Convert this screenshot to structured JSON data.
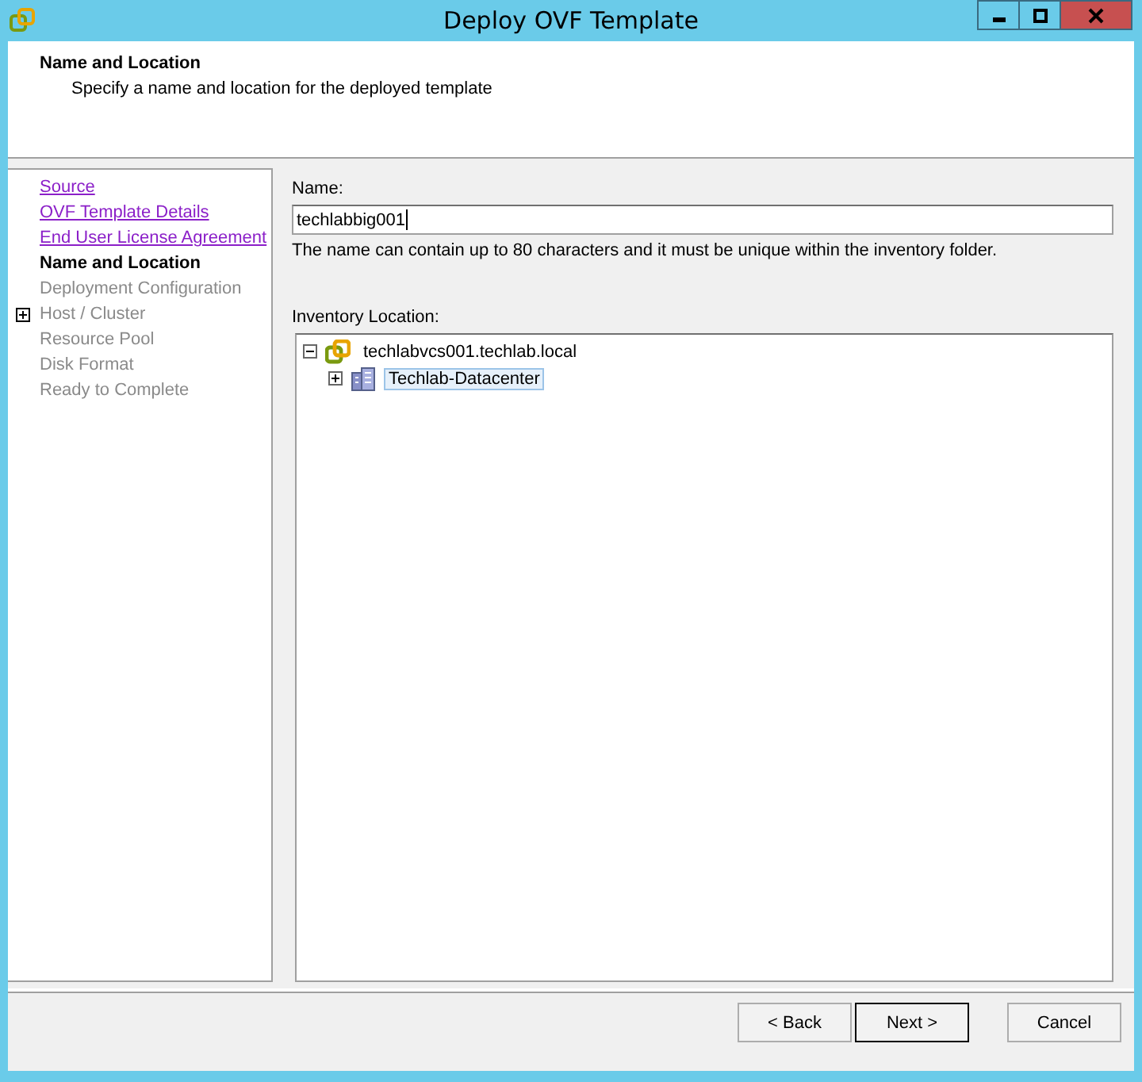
{
  "window": {
    "title": "Deploy OVF Template"
  },
  "header": {
    "title": "Name and Location",
    "subtitle": "Specify a name and location for the deployed template"
  },
  "steps": [
    {
      "label": "Source",
      "kind": "visited",
      "expandable": false
    },
    {
      "label": "OVF Template Details",
      "kind": "visited",
      "expandable": false
    },
    {
      "label": "End User License Agreement",
      "kind": "visited",
      "expandable": false
    },
    {
      "label": "Name and Location",
      "kind": "current",
      "expandable": false
    },
    {
      "label": "Deployment Configuration",
      "kind": "pending",
      "expandable": false
    },
    {
      "label": "Host / Cluster",
      "kind": "pending",
      "expandable": true
    },
    {
      "label": "Resource Pool",
      "kind": "pending",
      "expandable": false
    },
    {
      "label": "Disk Format",
      "kind": "pending",
      "expandable": false
    },
    {
      "label": "Ready to Complete",
      "kind": "pending",
      "expandable": false
    }
  ],
  "name_field": {
    "label": "Name:",
    "value": "techlabbig001",
    "hint": "The name can contain up to 80 characters and it must be unique within the inventory folder."
  },
  "inventory": {
    "label": "Inventory Location:",
    "tree": [
      {
        "label": "techlabvcs001.techlab.local",
        "kind": "vcenter",
        "expanded": true,
        "selected": false,
        "children": [
          {
            "label": "Techlab-Datacenter",
            "kind": "datacenter",
            "expanded": false,
            "selected": true
          }
        ]
      }
    ]
  },
  "buttons": [
    {
      "label": "< Back",
      "default": false
    },
    {
      "label": "Next >",
      "default": true
    },
    {
      "label": "Cancel",
      "default": false
    }
  ]
}
